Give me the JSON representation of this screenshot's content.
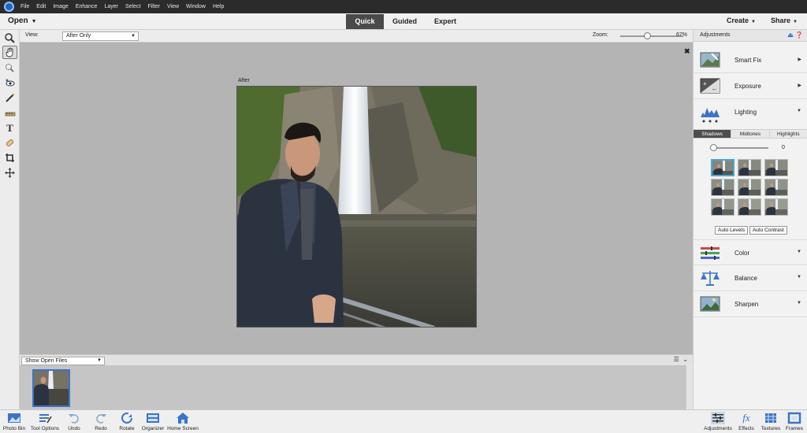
{
  "menu": [
    "File",
    "Edit",
    "Image",
    "Enhance",
    "Layer",
    "Select",
    "Filter",
    "View",
    "Window",
    "Help"
  ],
  "modebar": {
    "open": "Open",
    "modes": [
      "Quick",
      "Guided",
      "Expert"
    ],
    "create": "Create",
    "share": "Share"
  },
  "options": {
    "view_label": "View:",
    "view_value": "After Only",
    "zoom_label": "Zoom:",
    "zoom_value": "67%",
    "zoom_fraction": 0.42
  },
  "canvas": {
    "after_label": "After"
  },
  "bin": {
    "select_value": "Show Open Files"
  },
  "panel": {
    "title": "Adjustments",
    "adjustments": [
      {
        "label": "Smart Fix",
        "icon": "smart-fix-icon"
      },
      {
        "label": "Exposure",
        "icon": "exposure-icon"
      },
      {
        "label": "Lighting",
        "icon": "lighting-icon"
      },
      {
        "label": "Color",
        "icon": "color-icon"
      },
      {
        "label": "Balance",
        "icon": "balance-icon"
      },
      {
        "label": "Sharpen",
        "icon": "sharpen-icon"
      }
    ],
    "lighting_tabs": [
      "Shadows",
      "Midtones",
      "Highlights"
    ],
    "shadows_value": "0",
    "auto_levels": "Auto Levels",
    "auto_contrast": "Auto Contrast"
  },
  "taskbar": {
    "left": [
      "Photo Bin",
      "Tool Options",
      "Undo",
      "Redo",
      "Rotate",
      "Organizer",
      "Home Screen"
    ],
    "right": [
      "Adjustments",
      "Effects",
      "Textures",
      "Frames"
    ]
  },
  "colors": {
    "accent": "#3b74c7",
    "active_mode": "#4a4a4a"
  }
}
